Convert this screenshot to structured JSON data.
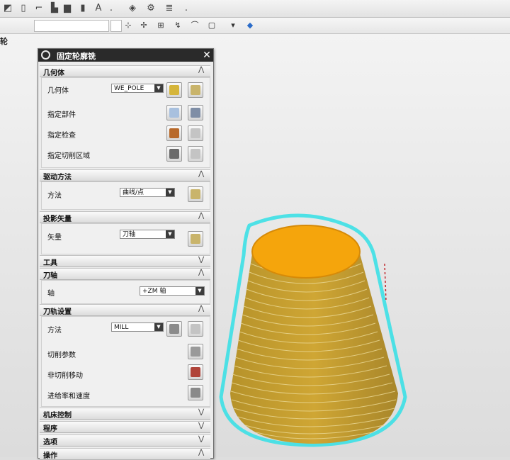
{
  "side_label": "轮",
  "dialog": {
    "title": "固定轮廓铣",
    "close": "✕",
    "sections": {
      "geometry": {
        "header": "几何体",
        "rows": {
          "geometry": {
            "label": "几何体",
            "value": "WE_POLE"
          },
          "part": {
            "label": "指定部件"
          },
          "check": {
            "label": "指定检查"
          },
          "cut_area": {
            "label": "指定切削区域"
          }
        }
      },
      "drive": {
        "header": "驱动方法",
        "rows": {
          "method": {
            "label": "方法",
            "value": "曲线/点"
          }
        }
      },
      "projection": {
        "header": "投影矢量",
        "rows": {
          "vector": {
            "label": "矢量",
            "value": "刀轴"
          }
        }
      },
      "tool": {
        "header": "工具"
      },
      "tool_axis": {
        "header": "刀轴",
        "rows": {
          "axis": {
            "label": "轴",
            "value": "+ZM 轴"
          }
        }
      },
      "tool_path": {
        "header": "刀轨设置",
        "rows": {
          "method": {
            "label": "方法",
            "value": "MILL"
          },
          "cut_params": {
            "label": "切削参数"
          },
          "non_cut": {
            "label": "非切削移动"
          },
          "feeds": {
            "label": "进给率和速度"
          }
        }
      },
      "machine": {
        "header": "机床控制"
      },
      "program": {
        "header": "程序"
      },
      "options": {
        "header": "选项"
      },
      "actions": {
        "header": "操作"
      }
    }
  },
  "model": {
    "colors": {
      "top": "#f5a50c",
      "side": "#c6a12b",
      "toolpath": "#3ce0e6"
    }
  }
}
